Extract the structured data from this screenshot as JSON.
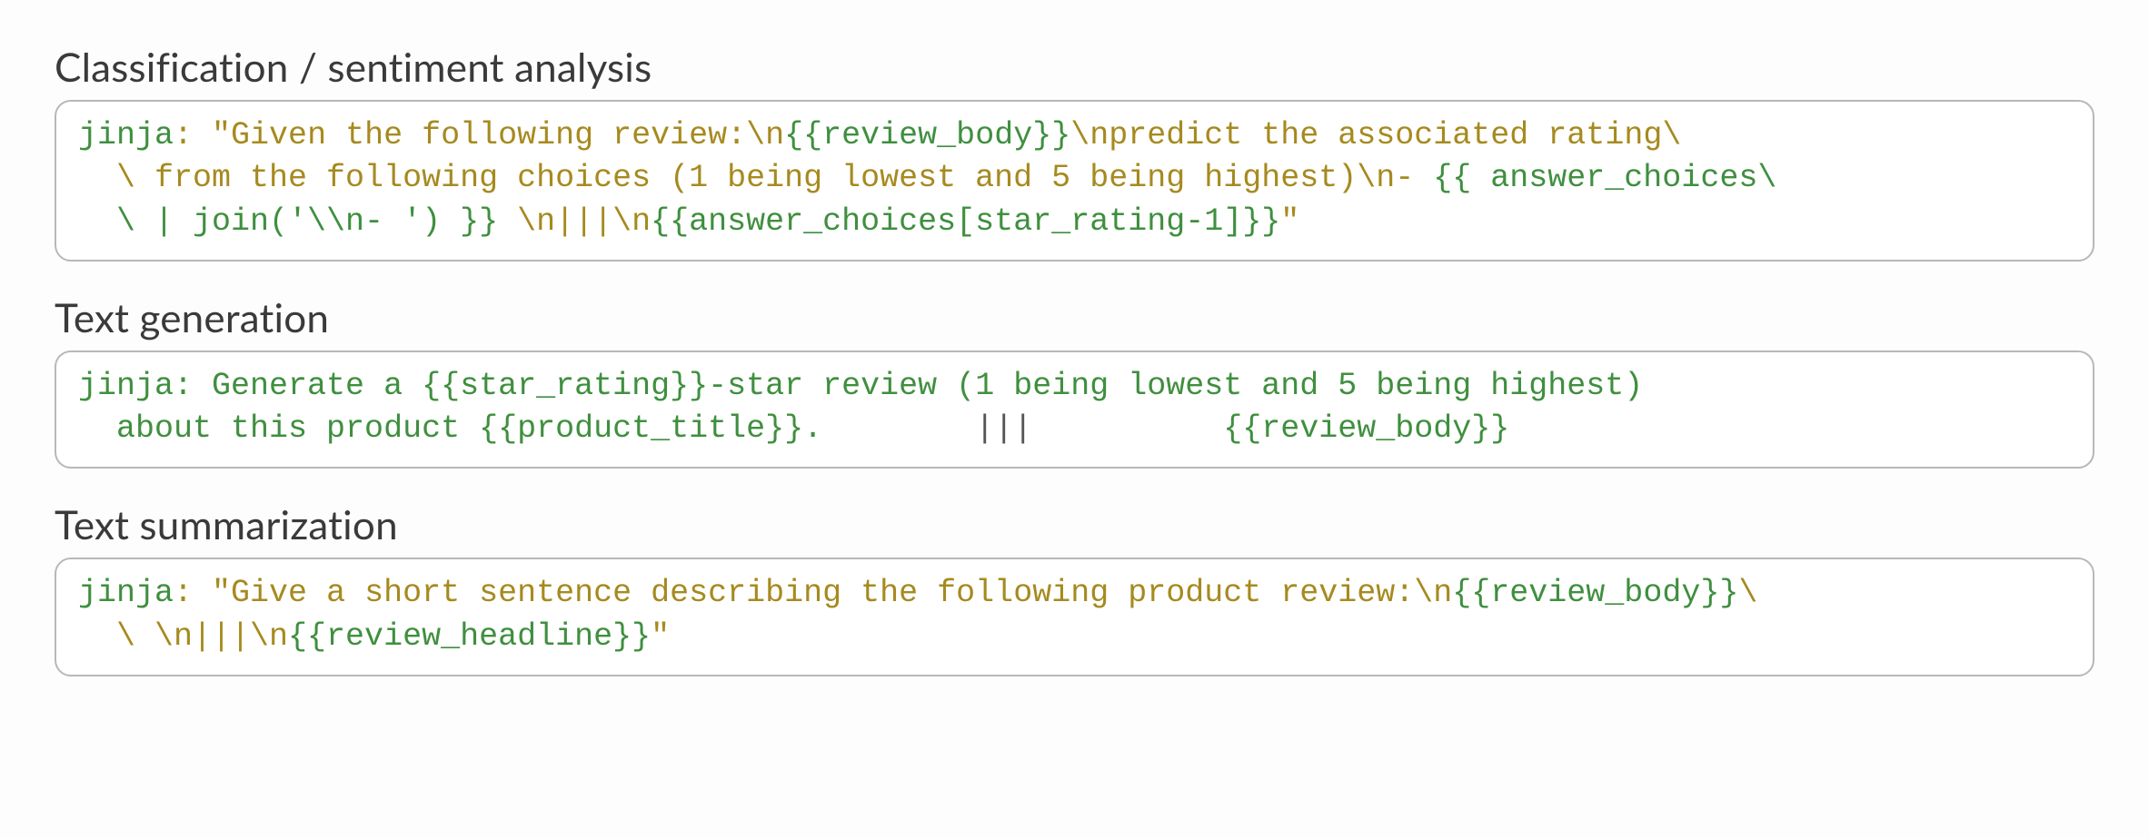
{
  "sections": [
    {
      "title": "Classification / sentiment analysis",
      "code": [
        {
          "cls": "k-key",
          "t": "jinja"
        },
        {
          "cls": "k-str",
          "t": ": "
        },
        {
          "cls": "k-str",
          "t": "\"Given the following review:\\n"
        },
        {
          "cls": "k-tmpl",
          "t": "{{review_body}}"
        },
        {
          "cls": "k-str",
          "t": "\\npredict the associated rating\\\n  \\ from the following choices (1 being lowest and 5 being highest)\\n- "
        },
        {
          "cls": "k-tmpl",
          "t": "{{ answer_choices\\\n  \\ | join('\\\\n- ') }}"
        },
        {
          "cls": "k-str",
          "t": " \\n|||\\n"
        },
        {
          "cls": "k-tmpl",
          "t": "{{answer_choices[star_rating-1]}}"
        },
        {
          "cls": "k-str",
          "t": "\""
        }
      ]
    },
    {
      "title": "Text generation",
      "code": [
        {
          "cls": "k-key",
          "t": "jinja"
        },
        {
          "cls": "k-plain",
          "t": ": Generate a "
        },
        {
          "cls": "k-tmpl",
          "t": "{{star_rating}}"
        },
        {
          "cls": "k-plain",
          "t": "-star review (1 being lowest and 5 being highest)\n  about this product "
        },
        {
          "cls": "k-tmpl",
          "t": "{{product_title}}"
        },
        {
          "cls": "k-plain",
          "t": ".        "
        },
        {
          "cls": "k-sep",
          "t": "|||"
        },
        {
          "cls": "k-plain",
          "t": "          "
        },
        {
          "cls": "k-tmpl",
          "t": "{{review_body}}"
        }
      ]
    },
    {
      "title": "Text summarization",
      "code": [
        {
          "cls": "k-key",
          "t": "jinja"
        },
        {
          "cls": "k-str",
          "t": ": "
        },
        {
          "cls": "k-str",
          "t": "\"Give a short sentence describing the following product review:\\n"
        },
        {
          "cls": "k-tmpl",
          "t": "{{review_body}}"
        },
        {
          "cls": "k-str",
          "t": "\\\n  \\ \\n|||\\n"
        },
        {
          "cls": "k-tmpl",
          "t": "{{review_headline}}"
        },
        {
          "cls": "k-str",
          "t": "\""
        }
      ]
    }
  ]
}
